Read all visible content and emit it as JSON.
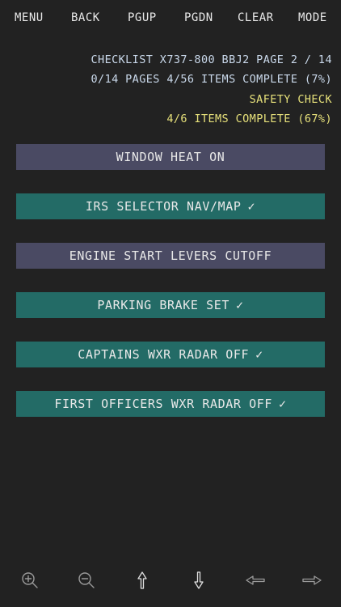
{
  "menu": {
    "menu_label": "MENU",
    "back_label": "BACK",
    "pgup_label": "PGUP",
    "pgdn_label": "PGDN",
    "clear_label": "CLEAR",
    "mode_label": "MODE"
  },
  "status": {
    "checklist_line": "CHECKLIST X737-800 BBJ2 PAGE 2 / 14",
    "progress_line": "0/14 PAGES 4/56 ITEMS COMPLETE (7%)",
    "section_title": "SAFETY CHECK",
    "section_progress": "4/6 ITEMS COMPLETE (67%)"
  },
  "items": [
    {
      "label": "WINDOW HEAT ON",
      "check": "",
      "done": false
    },
    {
      "label": "IRS SELECTOR NAV/MAP",
      "check": "✓",
      "done": true
    },
    {
      "label": "ENGINE START LEVERS CUTOFF",
      "check": "",
      "done": false
    },
    {
      "label": "PARKING BRAKE SET",
      "check": "✓",
      "done": true
    },
    {
      "label": "CAPTAINS WXR RADAR OFF",
      "check": "✓",
      "done": true
    },
    {
      "label": "FIRST OFFICERS WXR RADAR OFF",
      "check": "✓",
      "done": true
    }
  ],
  "toolbar": {
    "icons": [
      "zoom-in-icon",
      "zoom-out-icon",
      "arrow-up-icon",
      "arrow-down-icon",
      "arrow-left-icon",
      "arrow-right-icon"
    ]
  },
  "colors": {
    "background": "#222222",
    "pending_item": "#4a4a63",
    "done_item": "#236b66",
    "status_text": "#c9d8ea",
    "highlight_text": "#e6e07a",
    "icon": "#9a9a9a"
  }
}
